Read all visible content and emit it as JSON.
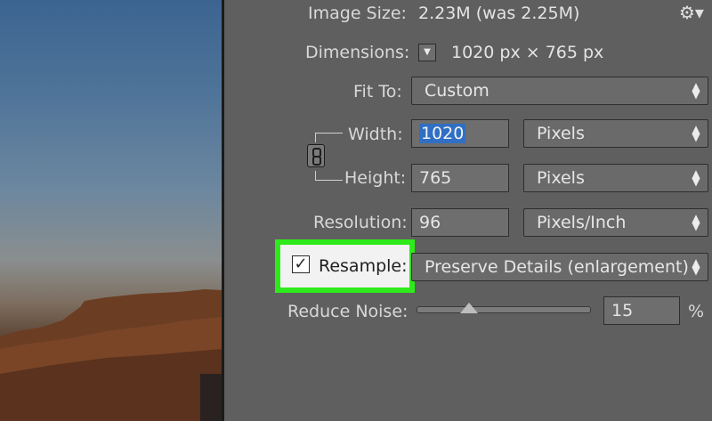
{
  "image_size": {
    "label": "Image Size:",
    "value": "2.23M (was 2.25M)"
  },
  "dimensions": {
    "label": "Dimensions:",
    "value": "1020 px  ×  765 px"
  },
  "fit_to": {
    "label": "Fit To:",
    "value": "Custom"
  },
  "width": {
    "label": "Width:",
    "value": "1020",
    "unit": "Pixels"
  },
  "height": {
    "label": "Height:",
    "value": "765",
    "unit": "Pixels"
  },
  "resolution": {
    "label": "Resolution:",
    "value": "96",
    "unit": "Pixels/Inch"
  },
  "resample": {
    "label": "Resample:",
    "checked": true,
    "method": "Preserve Details (enlargement)"
  },
  "reduce_noise": {
    "label": "Reduce Noise:",
    "value": "15",
    "unit": "%",
    "slider_fraction": 0.3
  },
  "icons": {
    "settings": "gear-icon",
    "dropdown": "triangle-down-icon",
    "link": "chain-link-icon"
  },
  "colors": {
    "highlight": "#2eea1a",
    "selection": "#2f6fc4"
  }
}
